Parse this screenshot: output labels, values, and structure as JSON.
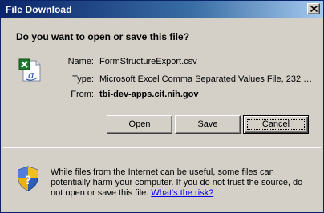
{
  "window": {
    "title": "File Download",
    "close_glyph": "✕"
  },
  "dialog": {
    "question": "Do you want to open or save this file?",
    "file_icon": "excel-csv-file-icon",
    "info": [
      {
        "label": "Name:",
        "value": "FormStructureExport.csv",
        "bold": false
      },
      {
        "label": "Type:",
        "value": "Microsoft Excel Comma Separated Values File, 232 …",
        "bold": false
      },
      {
        "label": "From:",
        "value": "tbi-dev-apps.cit.nih.gov",
        "bold": true
      }
    ],
    "buttons": {
      "open_label": "Open",
      "save_label": "Save",
      "cancel_label": "Cancel"
    }
  },
  "warning": {
    "icon": "security-shield-icon",
    "text": "While files from the Internet can be useful, some files can potentially harm your computer. If you do not trust the source, do not open or save this file. ",
    "link_text": "What's the risk?"
  },
  "colors": {
    "titlebar_start": "#0a246a",
    "titlebar_end": "#a6caf0",
    "dialog_bg": "#d4d0c8",
    "link": "#0000ee"
  }
}
